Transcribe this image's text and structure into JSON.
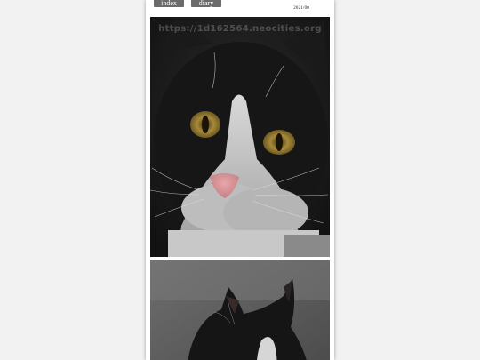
{
  "nav": {
    "index_label": "index",
    "diary_index_label": "diary index"
  },
  "entry": {
    "date": "2021/00"
  },
  "photos": [
    {
      "watermark": "https://1d162564.neocities.org",
      "subject": "black-and-white cat close-up"
    },
    {
      "subject": "black-and-white cat profile"
    }
  ],
  "colors": {
    "page_bg": "#f2f2f2",
    "content_bg": "#ffffff",
    "nav_button_bg": "#6b6b6b",
    "nav_button_text": "#ffffff"
  }
}
